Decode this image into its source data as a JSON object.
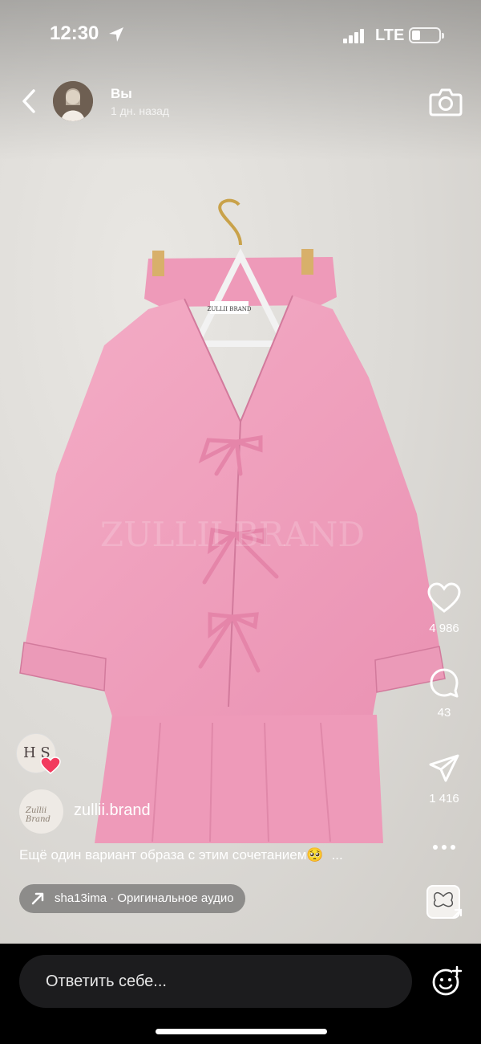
{
  "status_bar": {
    "time": "12:30",
    "network": "LTE"
  },
  "story_header": {
    "author": "Вы",
    "time_ago": "1 дн. назад",
    "back_icon": "chevron-left-icon",
    "camera_icon": "camera-icon"
  },
  "photo": {
    "label_text": "ZULLII BRAND",
    "watermark": "ZULLII BRAND",
    "garment_color": "#f1a4c0",
    "wall_color": "#dedcd8"
  },
  "actions": {
    "likes": "4 986",
    "comments": "43",
    "shares": "1 416"
  },
  "story_avatar": {
    "initials": "H S"
  },
  "account": {
    "avatar_text": "Zullii Brand",
    "name": "zullii.brand"
  },
  "caption": {
    "text": "Ещё один вариант образа с этим сочетанием🥺",
    "more": "..."
  },
  "audio": {
    "label": "sha13ima · Оригинальное аудио"
  },
  "reply": {
    "placeholder": "Ответить себе..."
  }
}
